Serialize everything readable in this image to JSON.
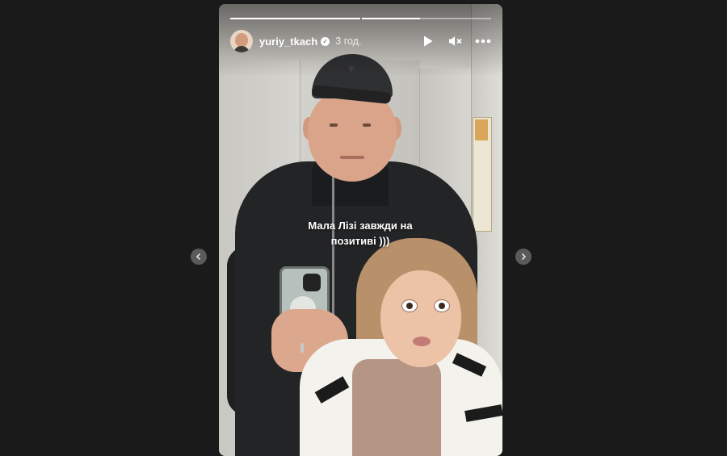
{
  "story": {
    "username": "yuriy_tkach",
    "verified_icon": "verified-badge-icon",
    "time_ago": "3 год.",
    "caption_line1": "Мала Лізі завжди на",
    "caption_line2": "позитиві )))",
    "progress": [
      1.0,
      0.45
    ],
    "controls": {
      "play_icon": "play-icon",
      "mute_icon": "muted-speaker-icon",
      "more_icon": "more-horizontal-icon"
    }
  },
  "navigation": {
    "prev_icon": "chevron-left-icon",
    "next_icon": "chevron-right-icon"
  },
  "colors": {
    "page_background": "#1a1a1a",
    "overlay_text": "#ffffff",
    "nav_button": "#5a5a5a"
  }
}
